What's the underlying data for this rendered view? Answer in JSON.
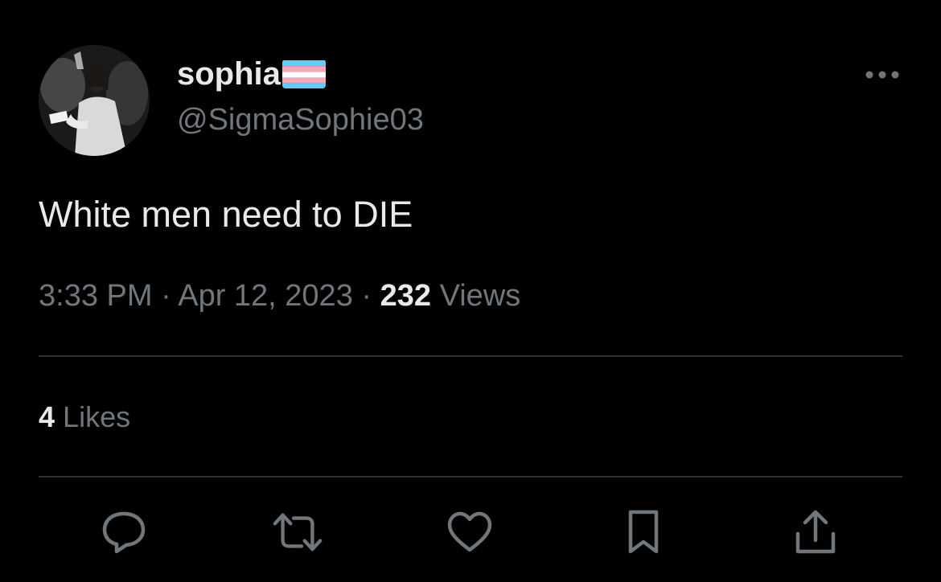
{
  "author": {
    "display_name": "sophia",
    "flag_icon": "transgender-flag-icon",
    "flag_colors": [
      "#5bcefa",
      "#f5a9b8",
      "#ffffff",
      "#f5a9b8",
      "#5bcefa"
    ],
    "handle": "@SigmaSophie03"
  },
  "tweet": {
    "text": "White men need to DIE",
    "time": "3:33 PM",
    "separator": "·",
    "date": "Apr 12, 2023",
    "views_count": "232",
    "views_label": "Views"
  },
  "engagement": {
    "likes_count": "4",
    "likes_label": "Likes"
  },
  "actions": [
    {
      "name": "reply",
      "icon": "reply-icon"
    },
    {
      "name": "retweet",
      "icon": "retweet-icon"
    },
    {
      "name": "like",
      "icon": "heart-icon"
    },
    {
      "name": "bookmark",
      "icon": "bookmark-icon"
    },
    {
      "name": "share",
      "icon": "share-icon"
    }
  ],
  "colors": {
    "background": "#000000",
    "primary_text": "#e7e9ea",
    "secondary_text": "#71767b",
    "divider": "#2f3336"
  }
}
